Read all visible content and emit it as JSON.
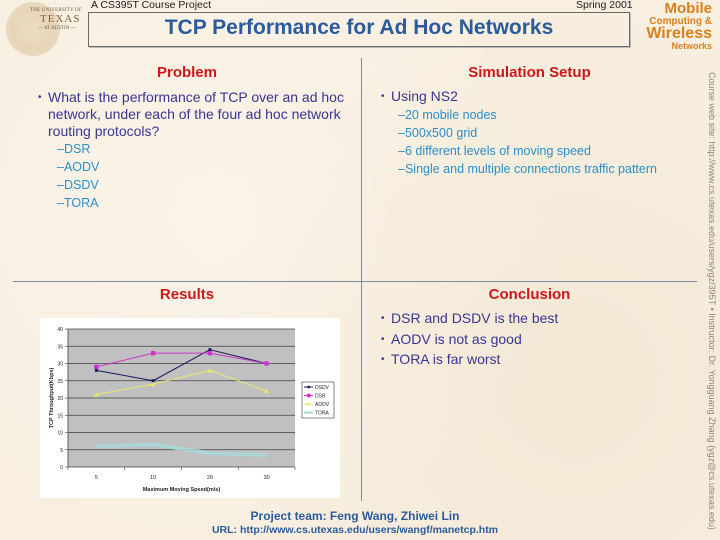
{
  "header": {
    "course_label": "A CS395T Course Project",
    "term_label": "Spring 2001",
    "title": "TCP Performance for Ad Hoc Networks",
    "logo": {
      "line1": "THE UNIVERSITY OF",
      "line2": "TEXAS",
      "line3": "— AT AUSTIN —"
    },
    "brand": {
      "mobile": "Mobile",
      "computing": "Computing &",
      "wireless": "Wireless",
      "networks": "Networks"
    }
  },
  "side_text": "Course web site: http://www.cs.utexas.edu/users/ygz/395T • Instructor: Dr. Yongguang Zhang (ygz@cs.utexas.edu)",
  "sections": {
    "problem": {
      "heading": "Problem",
      "bullet": "What is the performance of TCP over an ad hoc network, under each of the four ad hoc network routing protocols?",
      "subitems": [
        "–DSR",
        "–AODV",
        "–DSDV",
        "–TORA"
      ]
    },
    "setup": {
      "heading": "Simulation Setup",
      "bullet": "Using NS2",
      "subitems": [
        "–20 mobile nodes",
        "–500x500 grid",
        "–6 different levels of moving speed",
        "–Single and multiple connections traffic pattern"
      ]
    },
    "results": {
      "heading": "Results"
    },
    "conclusion": {
      "heading": "Conclusion",
      "bullets": [
        "DSR and DSDV is the best",
        "AODV is not as good",
        "TORA is far worst"
      ]
    }
  },
  "footer": {
    "team": "Project team: Feng Wang, Zhiwei Lin",
    "url": "URL: http://www.cs.utexas.edu/users/wangf/manetcp.htm"
  },
  "bullet_glyph": "•",
  "chart_data": {
    "type": "line",
    "title": "",
    "xlabel": "Maximum Moving Speed(m/s)",
    "ylabel": "TCP Throughput(Kbps)",
    "categories": [
      "5",
      "10",
      "20",
      "30"
    ],
    "ylim": [
      0,
      40
    ],
    "yticks": [
      0,
      5,
      10,
      15,
      20,
      25,
      30,
      35,
      40
    ],
    "grid": true,
    "legend": "right",
    "series": [
      {
        "name": "DSDV",
        "values": [
          28,
          25,
          34,
          30
        ],
        "color": "#1a1a5e",
        "marker": "diamond"
      },
      {
        "name": "DSR",
        "values": [
          29,
          33,
          33,
          30
        ],
        "color": "#cc33cc",
        "marker": "square"
      },
      {
        "name": "AODV",
        "values": [
          21,
          24,
          28,
          22
        ],
        "color": "#e8e86a",
        "marker": "triangle"
      },
      {
        "name": "TORA",
        "values": [
          6,
          6.5,
          4,
          3.5
        ],
        "color": "#a8d8d8",
        "marker": "none"
      }
    ],
    "plot_bg": "#c0c0c0"
  }
}
